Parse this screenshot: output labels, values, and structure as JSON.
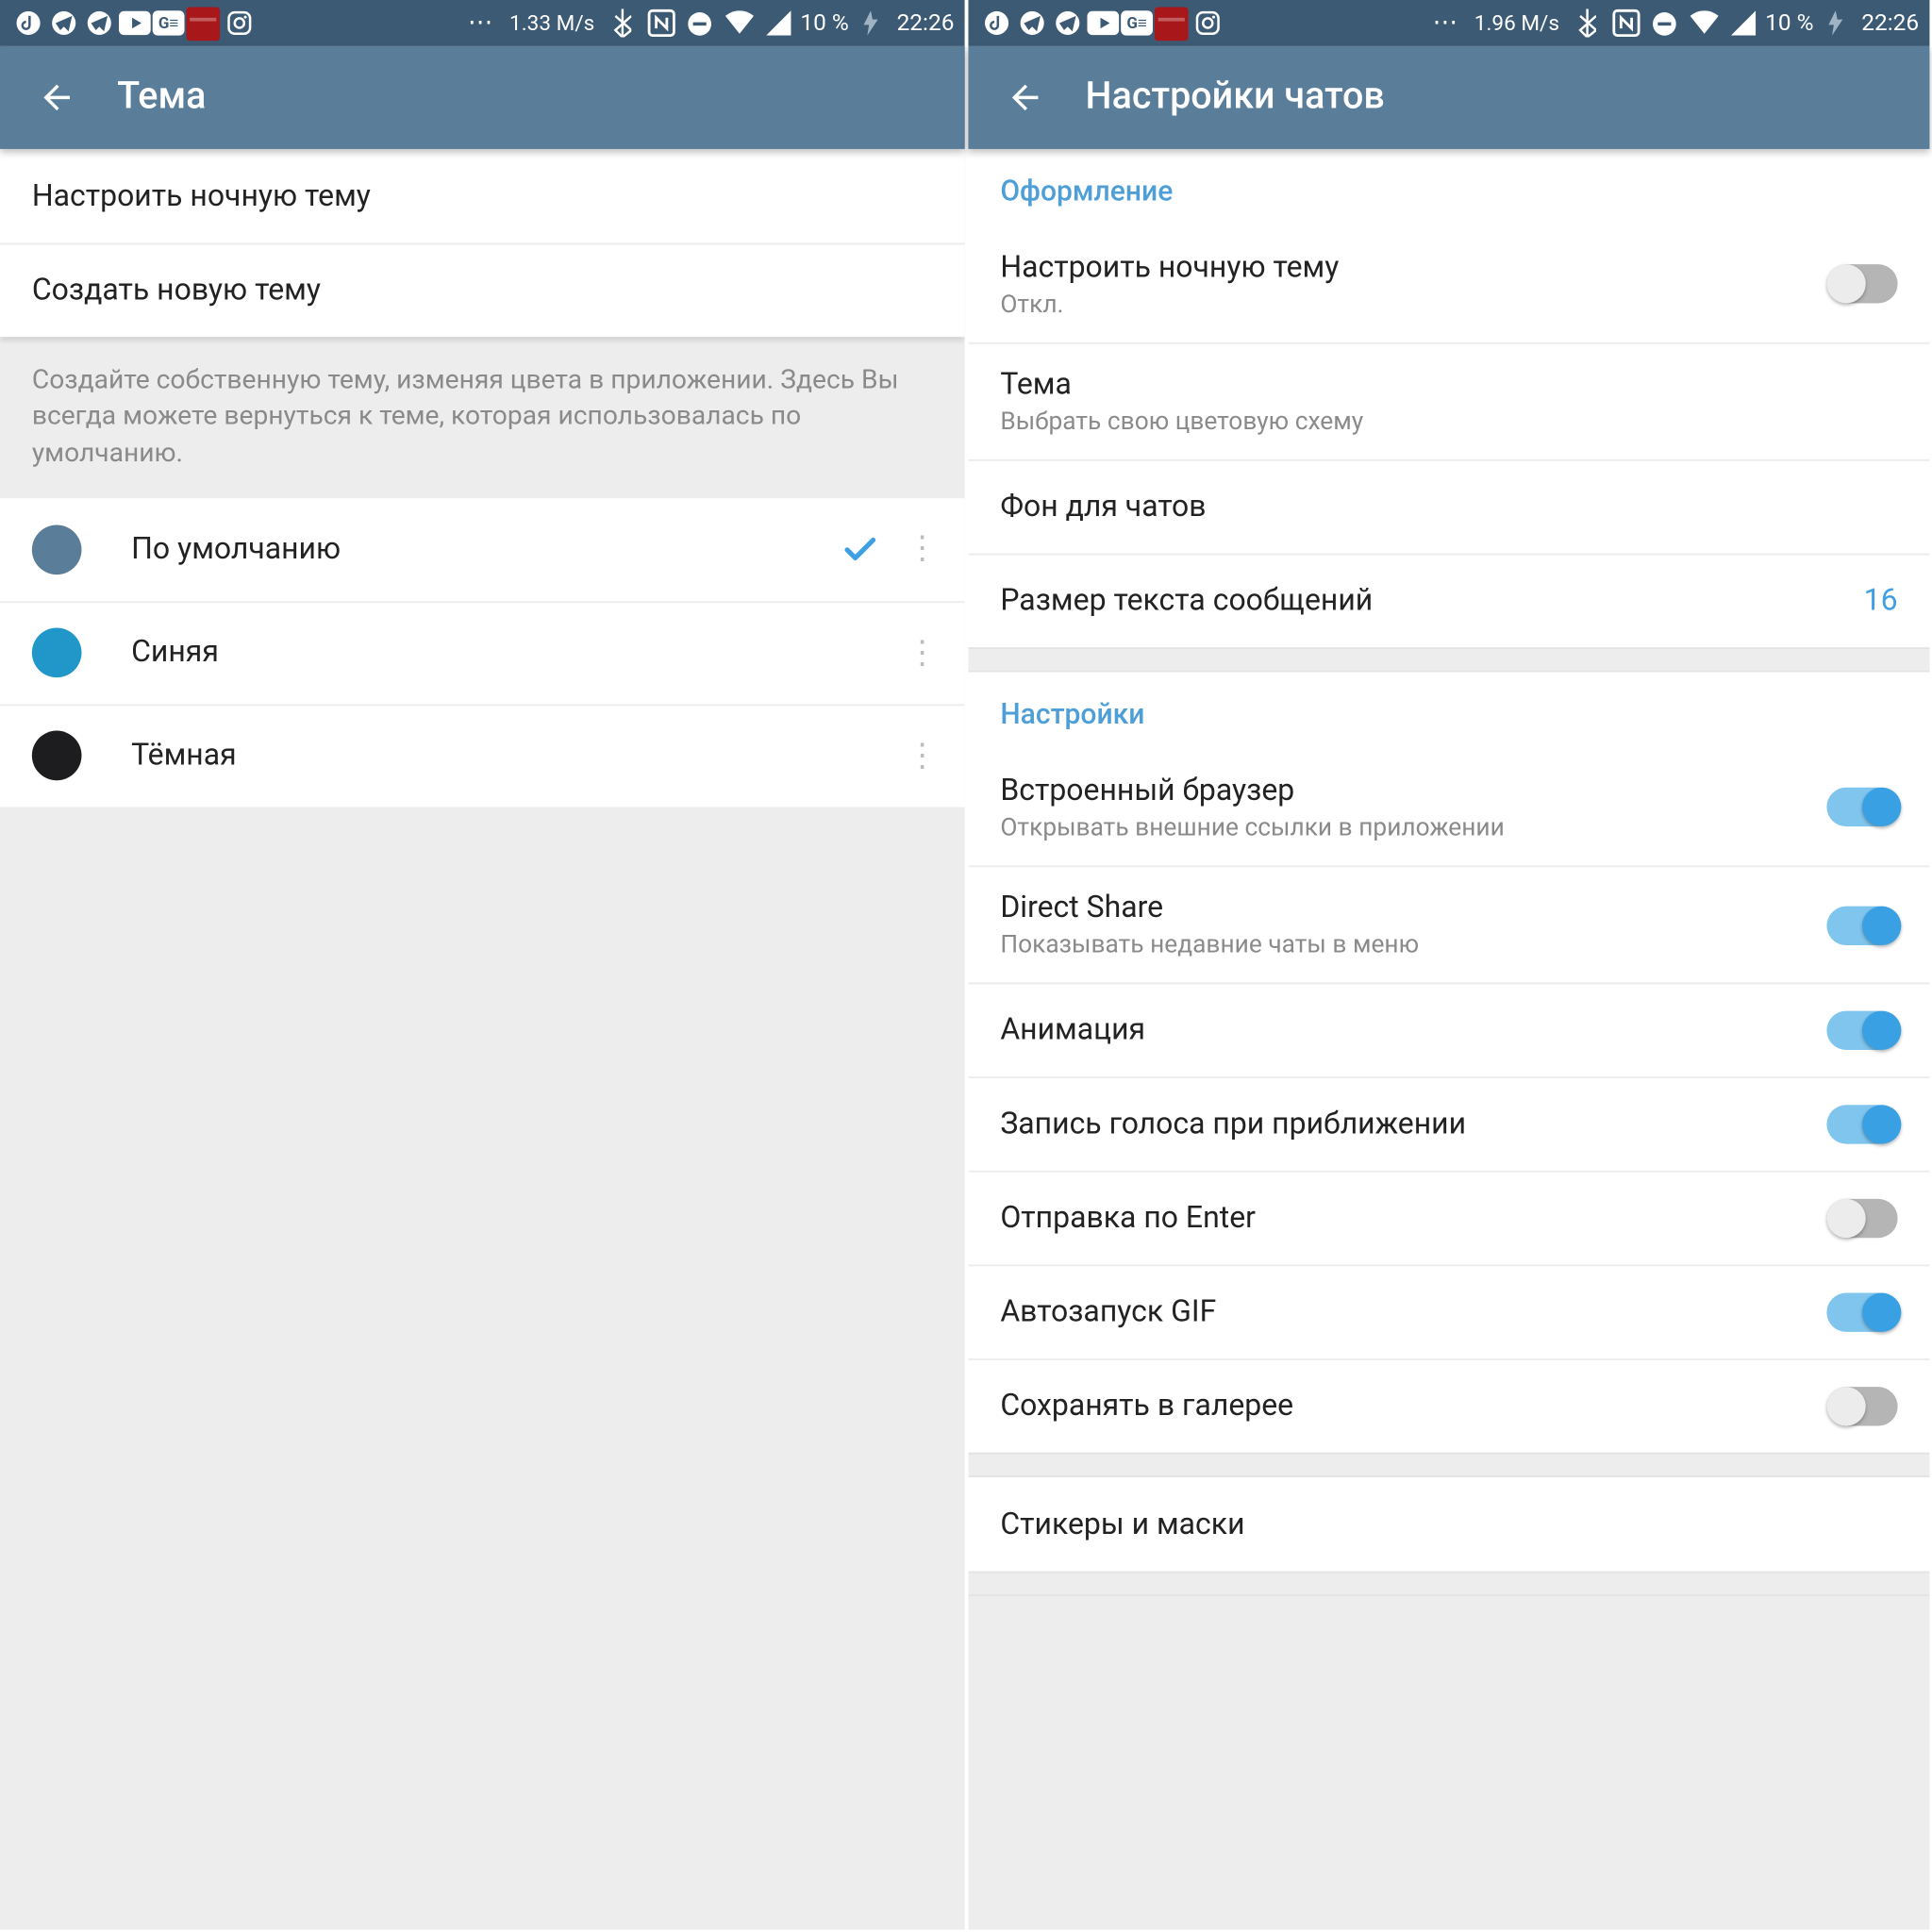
{
  "colors": {
    "header": "#5a7d99",
    "accent": "#3ea0e4",
    "sectionTitle": "#4e9fd7"
  },
  "left": {
    "status": {
      "speed": "1.33 M/s",
      "battery": "10 %",
      "clock": "22:26"
    },
    "title": "Тема",
    "menu": {
      "night": "Настроить ночную тему",
      "create": "Создать новую тему"
    },
    "hint": "Создайте собственную тему, изменяя цвета в приложении. Здесь Вы всегда можете вернуться к теме, которая использовалась по умолчанию.",
    "themes": [
      {
        "label": "По умолчанию",
        "color": "#5a7d99",
        "selected": true
      },
      {
        "label": "Синяя",
        "color": "#2196c9",
        "selected": false
      },
      {
        "label": "Тёмная",
        "color": "#1d1d1f",
        "selected": false
      }
    ]
  },
  "right": {
    "status": {
      "speed": "1.96 M/s",
      "battery": "10 %",
      "clock": "22:26"
    },
    "title": "Настройки чатов",
    "sections": {
      "design": {
        "header": "Оформление",
        "night": {
          "title": "Настроить ночную тему",
          "sub": "Откл."
        },
        "theme": {
          "title": "Тема",
          "sub": "Выбрать свою цветовую схему"
        },
        "background": {
          "title": "Фон для чатов"
        },
        "textsize": {
          "title": "Размер текста сообщений",
          "value": "16"
        }
      },
      "settings": {
        "header": "Настройки",
        "browser": {
          "title": "Встроенный браузер",
          "sub": "Открывать внешние ссылки в приложении",
          "on": true
        },
        "directshare": {
          "title": "Direct Share",
          "sub": "Показывать недавние чаты в меню",
          "on": true
        },
        "anim": {
          "title": "Анимация",
          "on": true
        },
        "voice": {
          "title": "Запись голоса при приближении",
          "on": true
        },
        "enter": {
          "title": "Отправка по Enter",
          "on": false
        },
        "gif": {
          "title": "Автозапуск GIF",
          "on": true
        },
        "gallery": {
          "title": "Сохранять в галерее",
          "on": false
        }
      },
      "stickers": {
        "title": "Стикеры и маски"
      }
    }
  }
}
